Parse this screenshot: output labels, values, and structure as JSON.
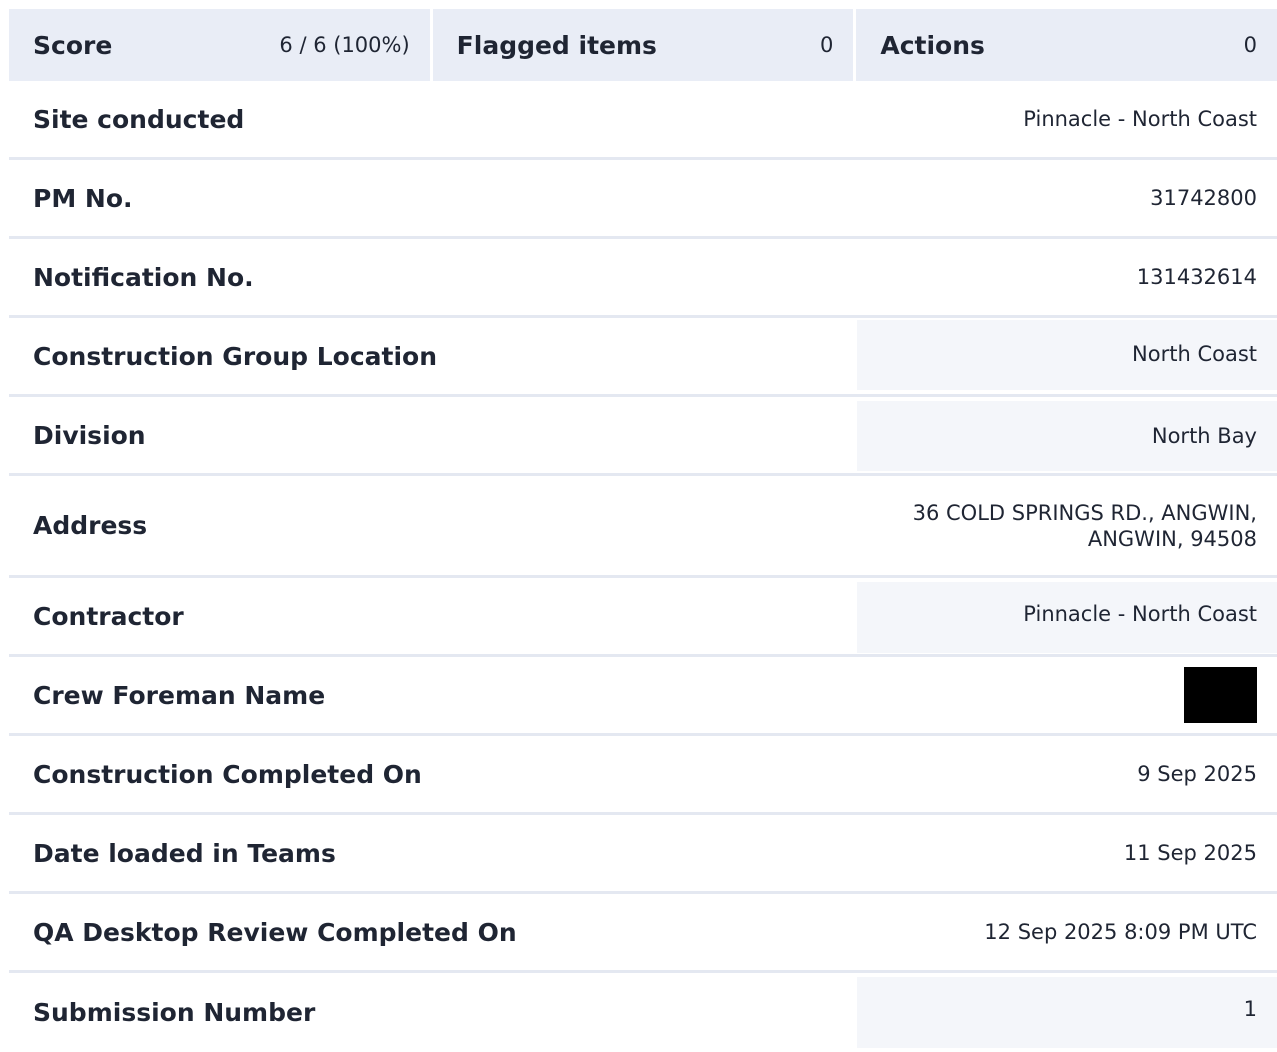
{
  "summary": {
    "score_label": "Score",
    "score_value": "6 / 6 (100%)",
    "flagged_label": "Flagged items",
    "flagged_value": "0",
    "actions_label": "Actions",
    "actions_value": "0"
  },
  "fields": {
    "site_conducted": {
      "label": "Site conducted",
      "value": "Pinnacle - North Coast"
    },
    "pm_no": {
      "label": "PM No.",
      "value": "31742800"
    },
    "notification_no": {
      "label": "Notification No.",
      "value": "131432614"
    },
    "construction_group_location": {
      "label": "Construction Group Location",
      "value": "North Coast"
    },
    "division": {
      "label": "Division",
      "value": "North Bay"
    },
    "address": {
      "label": "Address",
      "value_line1": "36 COLD SPRINGS RD., ANGWIN,",
      "value_line2": "ANGWIN, 94508"
    },
    "contractor": {
      "label": "Contractor",
      "value": "Pinnacle - North Coast"
    },
    "crew_foreman_name": {
      "label": "Crew Foreman Name"
    },
    "construction_completed_on": {
      "label": "Construction Completed On",
      "value": "9 Sep 2025"
    },
    "date_loaded_in_teams": {
      "label": "Date loaded in Teams",
      "value": "11 Sep 2025"
    },
    "qa_desktop_review_completed_on": {
      "label": "QA Desktop Review Completed On",
      "value": "12 Sep 2025 8:09 PM UTC"
    },
    "submission_number": {
      "label": "Submission Number",
      "value": "1"
    }
  }
}
